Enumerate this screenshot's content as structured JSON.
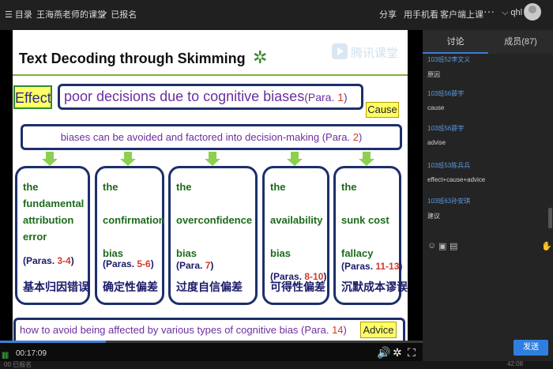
{
  "topbar": {
    "menu_label": "☰ 目录",
    "course_title": "王海燕老师的课堂",
    "enrolled_label": "✓ 已报名",
    "share_label": "分享",
    "mobile_label": "用手机看",
    "client_label": "客户端上课",
    "more_label": "···",
    "user_label": "⌵ qhl"
  },
  "slide": {
    "title": "Text Decoding through Skimming",
    "leaf_icon": "✲",
    "watermark_text": "腾讯课堂",
    "effect_tag": "Effect",
    "effect_text": "poor decisions due to cognitive biases",
    "effect_para_prefix": "(Para. ",
    "effect_para_num": "1",
    "para_suffix": ")",
    "cause_tag": "Cause",
    "cause_text": "biases can be avoided and factored into decision-making ",
    "cause_para_prefix": "(Para. ",
    "cause_para_num": "2",
    "biases": [
      {
        "name": "the\nfundamental\nattribution\nerror",
        "para_prefix": "(Paras. ",
        "para_num": "3-4",
        "para_suffix": ")",
        "cn": "基本归因错误"
      },
      {
        "name": "the\n\nconfirmation\n\nbias",
        "para_prefix": "(Paras. ",
        "para_num": "5-6",
        "para_suffix": ")",
        "cn": "确定性偏差"
      },
      {
        "name": "the\n\noverconfidence\n\nbias",
        "para_prefix": "(Para. ",
        "para_num": "7",
        "para_suffix": ")",
        "cn": "过度自信偏差"
      },
      {
        "name": "the\n\navailability\n\nbias",
        "para_prefix": "(Paras. ",
        "para_num": "8-10",
        "para_suffix": ")",
        "cn": "可得性偏差"
      },
      {
        "name": "the\n\nsunk cost\n\nfallacy",
        "para_prefix": "(Paras. ",
        "para_num": "11-13",
        "para_suffix": ")",
        "cn": "沉默成本谬误"
      }
    ],
    "advice_tag": "Advice",
    "advice_text": "how to avoid being affected by various types of cognitive bias ",
    "advice_para_prefix": "(Para. ",
    "advice_para_num": "14"
  },
  "player": {
    "time": "00:17:09",
    "progress": 0.25,
    "bars_icon": "||||||",
    "volume_icon": "🔊",
    "settings_icon": "✲",
    "fullscreen_icon": "⛶"
  },
  "panel": {
    "tab_discuss": "讨论",
    "tab_members": "成员(87)",
    "messages": [
      {
        "sender": "103班52李文义",
        "text": "原因"
      },
      {
        "sender": "103班56薛宇",
        "text": "cause"
      },
      {
        "sender": "103班56薛宇",
        "text": "advise"
      },
      {
        "sender": "103班53陈兵兵",
        "text": "effect+cause+advice"
      },
      {
        "sender": "103班63孙安琪",
        "text": "建议"
      }
    ],
    "send_label": "发送",
    "tools": {
      "emoji": "☺",
      "image": "▣",
      "file": "▤",
      "hand": "✋"
    }
  },
  "statusbar": {
    "left_text": "00  已报名",
    "right_text": "42:08"
  },
  "colors": {
    "accent": "#2f7fe0",
    "sender": "#5b9be6",
    "slide_green": "#1c6b1c",
    "slide_purple": "#6b2fa0",
    "slide_red": "#d23a2a"
  }
}
